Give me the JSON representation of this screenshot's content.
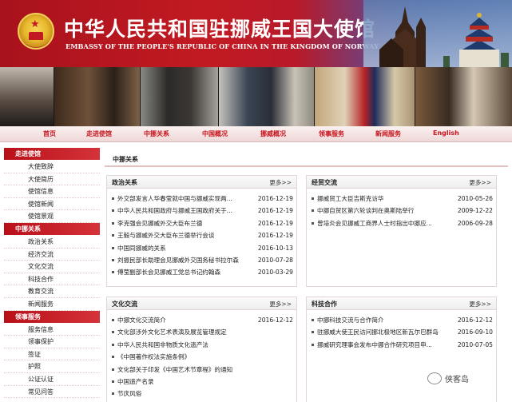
{
  "banner": {
    "title": "中华人民共和国驻挪威王国大使馆",
    "subtitle": "EMBASSY OF THE PEOPLE'S REPUBLIC OF CHINA IN THE KINGDOM OF NORWAY"
  },
  "nav": {
    "items": [
      "首页",
      "走进使馆",
      "中挪关系",
      "中国概况",
      "挪威概况",
      "领事服务",
      "新闻服务",
      "English"
    ]
  },
  "sidebar": {
    "sections": [
      {
        "title": "走进使馆",
        "items": [
          "大使致辞",
          "大使简历",
          "使馆信息",
          "使馆新闻",
          "使馆景观"
        ]
      },
      {
        "title": "中挪关系",
        "items": [
          "政治关系",
          "经济交流",
          "文化交流",
          "科技合作",
          "教育交流",
          "新闻服务"
        ]
      },
      {
        "title": "领事服务",
        "items": [
          "服务信息",
          "领事保护",
          "签证",
          "护照",
          "公证认证",
          "常见问答"
        ]
      }
    ]
  },
  "main": {
    "title": "中挪关系",
    "more_label": "更多>>",
    "panels": {
      "politics": {
        "title": "政治关系",
        "rows": [
          {
            "title": "外交部发言人华春莹就中国与挪威实现两...",
            "date": "2016-12-19"
          },
          {
            "title": "中华人民共和国政府与挪威王国政府关于...",
            "date": "2016-12-19"
          },
          {
            "title": "李克强会见挪威外交大臣布兰德",
            "date": "2016-12-19"
          },
          {
            "title": "王毅与挪威外交大臣布兰德举行会谈",
            "date": "2016-12-19"
          },
          {
            "title": "中国同挪威的关系",
            "date": "2016-10-13"
          },
          {
            "title": "刘振民部长助理会见挪威外交国务秘书拉尔森",
            "date": "2010-07-28"
          },
          {
            "title": "傅莹副部长会见挪威工党总书记约翰森",
            "date": "2010-03-29"
          }
        ]
      },
      "economy": {
        "title": "经贸交流",
        "rows": [
          {
            "title": "挪威贸工大臣吉斯克访华",
            "date": "2010-05-26"
          },
          {
            "title": "中挪自贸区第六轮谈判在奥斯陆举行",
            "date": "2009-12-22"
          },
          {
            "title": "曾培炎会见挪威工商界人士时指出中挪应...",
            "date": "2006-09-28"
          }
        ]
      },
      "culture": {
        "title": "文化交流",
        "rows": [
          {
            "title": "中挪文化交流简介",
            "date": "2016-12-12"
          },
          {
            "title": "文化部涉外文化艺术表演及展览管理规定",
            "date": ""
          },
          {
            "title": "中华人民共和国非物质文化遗产法",
            "date": ""
          },
          {
            "title": "《中国著作权法实施条例》",
            "date": ""
          },
          {
            "title": "文化部关于印发《中国艺术节章程》的通知",
            "date": ""
          },
          {
            "title": "中国遗产名录",
            "date": ""
          },
          {
            "title": "节庆风俗",
            "date": ""
          }
        ]
      },
      "science": {
        "title": "科技合作",
        "rows": [
          {
            "title": "中挪科技交流与合作简介",
            "date": "2016-12-12"
          },
          {
            "title": "驻挪威大使王民访问挪北极地区新瓦尔巴群岛",
            "date": "2016-09-10"
          },
          {
            "title": "挪威研究理事会发布中挪合作研究项目申...",
            "date": "2010-07-05"
          }
        ]
      }
    }
  },
  "watermark": {
    "text": "侠客岛"
  },
  "colors": {
    "brand_red": "#c21a22",
    "nav_text": "#c8151d",
    "sidebar_header": "#b81019"
  }
}
